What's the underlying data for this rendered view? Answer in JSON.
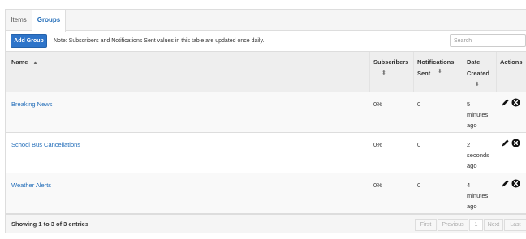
{
  "tabs": [
    {
      "label": "Items",
      "active": false
    },
    {
      "label": "Groups",
      "active": true
    }
  ],
  "toolbar": {
    "add_label": "Add Group",
    "note": "Note: Subscribers and Notifications Sent values in this table are updated once daily.",
    "search_placeholder": "Search"
  },
  "table": {
    "headers": {
      "name": "Name",
      "subscribers": "Subscribers",
      "notifications": "Notifications Sent",
      "date": "Date Created",
      "actions": "Actions"
    },
    "rows": [
      {
        "name": "Breaking News",
        "subscribers": "0%",
        "notifications": "0",
        "date": [
          "5",
          "minutes",
          "ago"
        ]
      },
      {
        "name": "School Bus Cancellations",
        "subscribers": "0%",
        "notifications": "0",
        "date": [
          "2",
          "seconds",
          "ago"
        ]
      },
      {
        "name": "Weather Alerts",
        "subscribers": "0%",
        "notifications": "0",
        "date": [
          "4",
          "minutes",
          "ago"
        ]
      }
    ]
  },
  "footer": {
    "info": "Showing 1 to 3 of 3 entries",
    "pagination": {
      "first": "First",
      "previous": "Previous",
      "page": "1",
      "next": "Next",
      "last": "Last"
    }
  },
  "colors": {
    "accent": "#2d74c9",
    "link": "#1f6bb8"
  },
  "icons": {
    "edit": "pencil-icon",
    "remove": "close-circle-icon",
    "sort": "sort-icon",
    "sort_asc": "sort-ascending-icon"
  }
}
